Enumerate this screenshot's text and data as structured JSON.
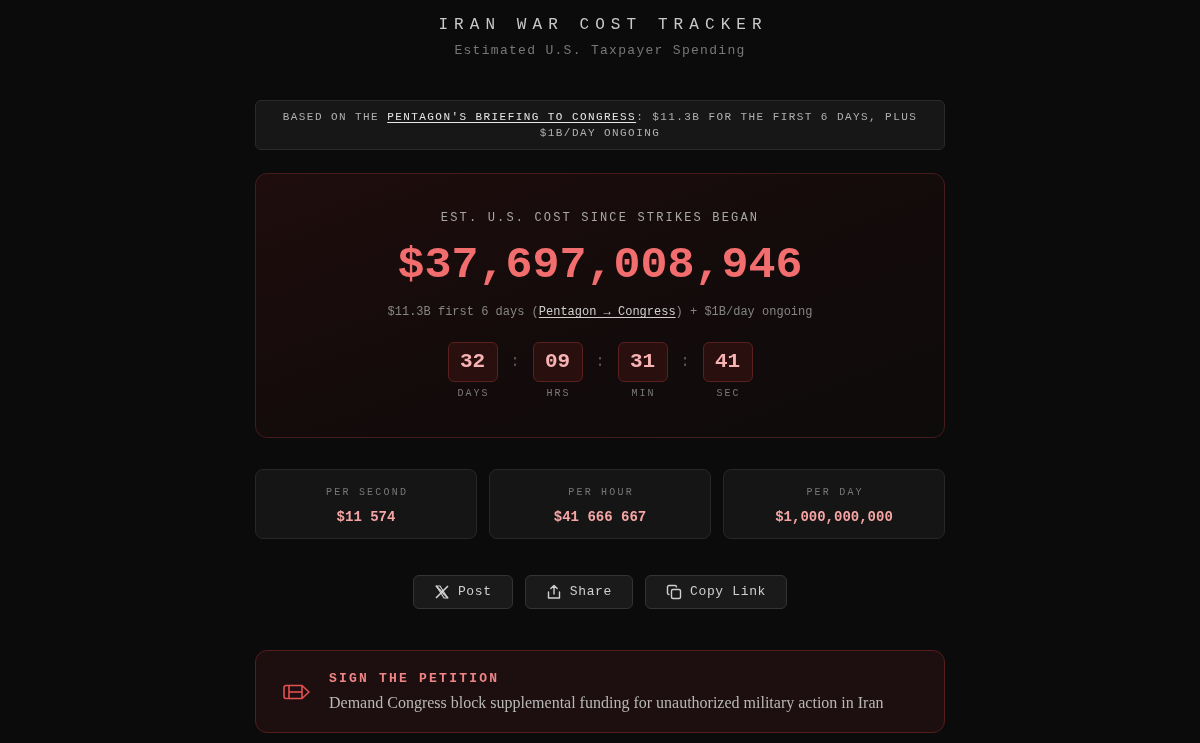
{
  "header": {
    "title": "IRAN WAR COST TRACKER",
    "subtitle": "Estimated U.S. Taxpayer Spending"
  },
  "notice": {
    "parts": [
      {
        "kind": "text",
        "text": "BASED ON THE "
      },
      {
        "kind": "link",
        "text": "PENTAGON'S BRIEFING TO CONGRESS"
      },
      {
        "kind": "text",
        "text": ": $11.3B FOR THE FIRST 6 DAYS, PLUS $1B/DAY ONGOING"
      }
    ]
  },
  "counter": {
    "label": "EST. U.S. COST SINCE STRIKES BEGAN",
    "total": "$37,697,008,946",
    "note_parts": [
      {
        "kind": "text",
        "text": "$11.3B first 6 days ("
      },
      {
        "kind": "link",
        "text": "Pentagon → Congress"
      },
      {
        "kind": "text",
        "text": ") + $1B/day ongoing"
      }
    ],
    "countdown": [
      {
        "value": "32",
        "unit": "DAYS",
        "separator": ":"
      },
      {
        "value": "09",
        "unit": "HRS",
        "separator": ":"
      },
      {
        "value": "31",
        "unit": "MIN",
        "separator": ":"
      },
      {
        "value": "41",
        "unit": "SEC"
      }
    ]
  },
  "rates": [
    {
      "label": "PER SECOND",
      "value": "$11 574"
    },
    {
      "label": "PER HOUR",
      "value": "$41 666 667"
    },
    {
      "label": "PER DAY",
      "value": "$1,000,000,000"
    }
  ],
  "actions": [
    {
      "kind": "x",
      "label": "Post"
    },
    {
      "kind": "share",
      "label": "Share"
    },
    {
      "kind": "copy",
      "label": "Copy Link"
    }
  ],
  "petition": {
    "title": "SIGN THE PETITION",
    "description": "Demand Congress block supplemental funding for unauthorized military action in Iran"
  }
}
